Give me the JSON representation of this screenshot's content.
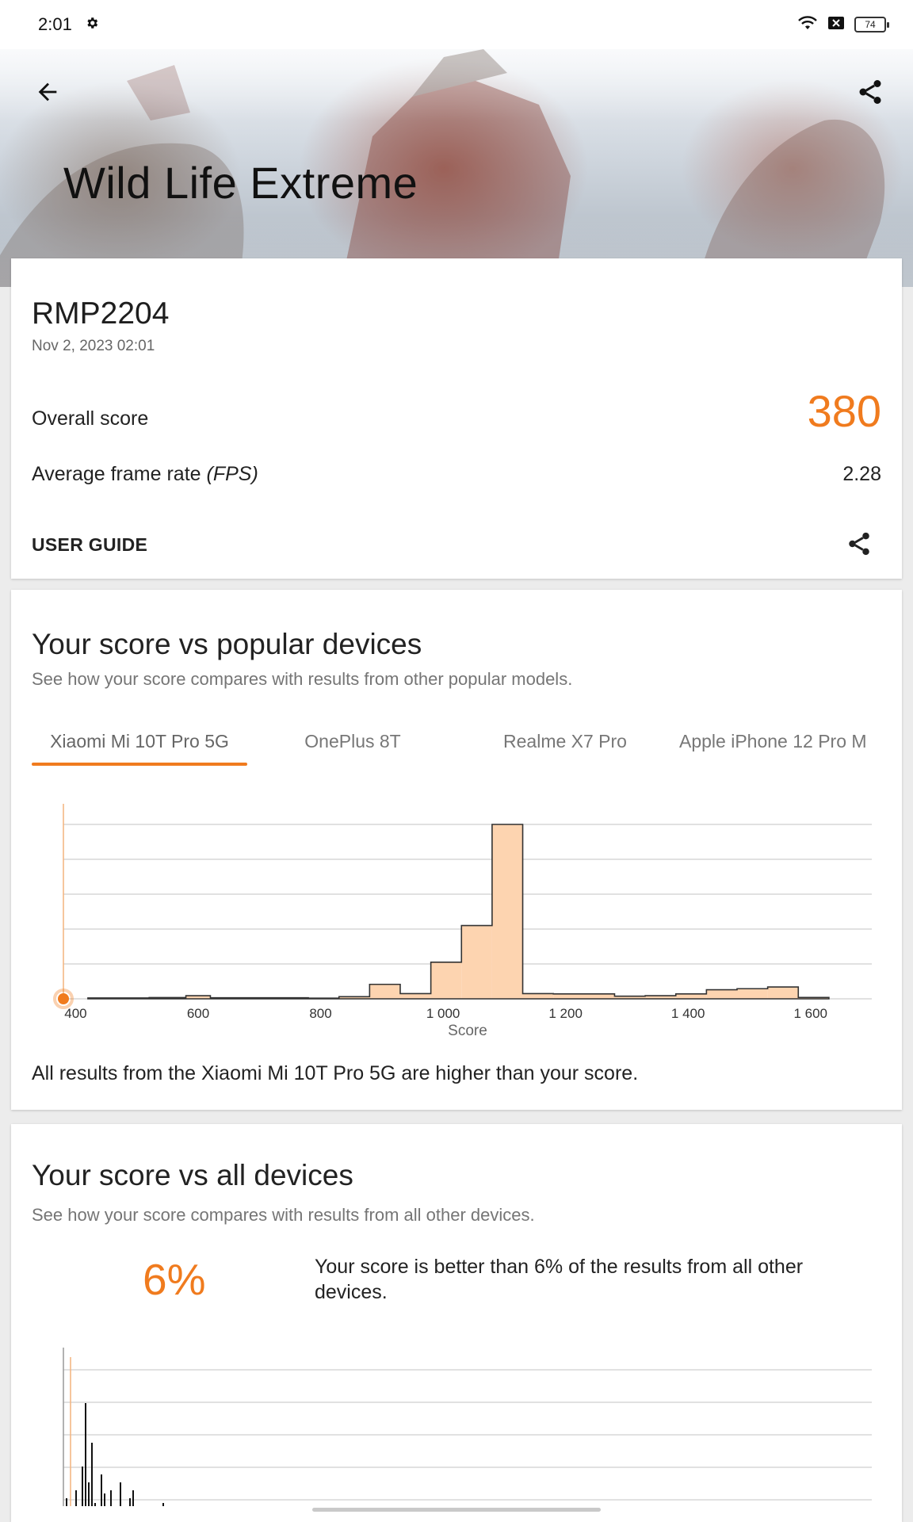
{
  "status_bar": {
    "time": "2:01",
    "battery": "74"
  },
  "hero": {
    "title": "Wild Life Extreme"
  },
  "result": {
    "device": "RMP2204",
    "date": "Nov 2, 2023 02:01",
    "overall_label": "Overall score",
    "overall_value": "380",
    "fps_label": "Average frame rate",
    "fps_unit": "(FPS)",
    "fps_value": "2.28",
    "user_guide": "USER GUIDE"
  },
  "popular": {
    "title": "Your score vs popular devices",
    "description": "See how your score compares with results from other popular models.",
    "tabs": [
      {
        "label": "Xiaomi Mi 10T Pro 5G",
        "active": true
      },
      {
        "label": "OnePlus 8T",
        "active": false
      },
      {
        "label": "Realme X7 Pro",
        "active": false
      },
      {
        "label": "Apple iPhone 12 Pro M",
        "active": false
      }
    ],
    "caption": "All results from the Xiaomi Mi 10T Pro 5G are higher than your score."
  },
  "all_devices": {
    "title": "Your score vs all devices",
    "description": "See how your score compares with results from all other devices.",
    "percent": "6%",
    "percent_text": "Your score is better than 6% of the results from all other devices."
  },
  "colors": {
    "accent": "#f07b1e",
    "histogram_fill": "#fdd4b0",
    "histogram_stroke": "#333333"
  },
  "chart_data": [
    {
      "type": "area",
      "xlabel": "Score",
      "ylabel": "",
      "xlim": [
        380,
        1700
      ],
      "ylim": [
        0,
        1
      ],
      "x_ticks": [
        400,
        600,
        800,
        1000,
        1200,
        1400,
        1600
      ],
      "x_tick_labels": [
        "400",
        "600",
        "800",
        "1 000",
        "1 200",
        "1 400",
        "1 600"
      ],
      "grid": true,
      "your_score": 380,
      "bins": [
        {
          "x0": 420,
          "x1": 520,
          "value": 0.005
        },
        {
          "x0": 520,
          "x1": 580,
          "value": 0.007
        },
        {
          "x0": 580,
          "x1": 620,
          "value": 0.018
        },
        {
          "x0": 620,
          "x1": 780,
          "value": 0.006
        },
        {
          "x0": 780,
          "x1": 830,
          "value": 0.004
        },
        {
          "x0": 830,
          "x1": 880,
          "value": 0.012
        },
        {
          "x0": 880,
          "x1": 930,
          "value": 0.083
        },
        {
          "x0": 930,
          "x1": 980,
          "value": 0.03
        },
        {
          "x0": 980,
          "x1": 1030,
          "value": 0.21
        },
        {
          "x0": 1030,
          "x1": 1080,
          "value": 0.42
        },
        {
          "x0": 1080,
          "x1": 1130,
          "value": 1.0
        },
        {
          "x0": 1130,
          "x1": 1180,
          "value": 0.03
        },
        {
          "x0": 1180,
          "x1": 1280,
          "value": 0.028
        },
        {
          "x0": 1280,
          "x1": 1330,
          "value": 0.015
        },
        {
          "x0": 1330,
          "x1": 1380,
          "value": 0.018
        },
        {
          "x0": 1380,
          "x1": 1430,
          "value": 0.028
        },
        {
          "x0": 1430,
          "x1": 1480,
          "value": 0.052
        },
        {
          "x0": 1480,
          "x1": 1530,
          "value": 0.058
        },
        {
          "x0": 1530,
          "x1": 1580,
          "value": 0.068
        },
        {
          "x0": 1580,
          "x1": 1630,
          "value": 0.008
        }
      ]
    },
    {
      "type": "bar",
      "xlabel": "",
      "ylabel": "",
      "grid": true,
      "your_score_marker": true,
      "spikes": [
        0.25,
        0.05,
        0.18,
        0.3,
        0.12,
        0.45,
        0.85,
        0.35,
        0.6,
        0.22,
        0.1,
        0.4,
        0.28,
        0.15,
        0.3,
        0.2,
        0.12,
        0.35,
        0.18,
        0.08,
        0.25,
        0.3
      ]
    }
  ]
}
